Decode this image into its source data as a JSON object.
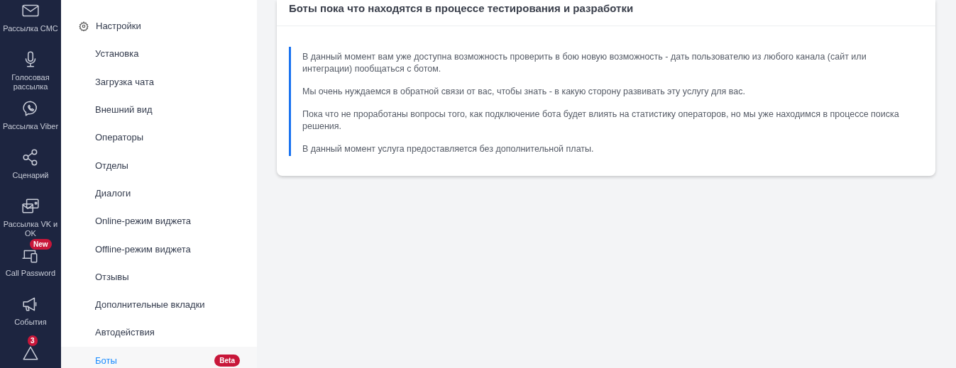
{
  "nav_rail": {
    "items": [
      {
        "label": "Рассылка СМС"
      },
      {
        "label": "Голосовая рассылка"
      },
      {
        "label": "Рассылка Viber"
      },
      {
        "label": "Сценарий"
      },
      {
        "label": "Рассылка VK и OK"
      },
      {
        "label": "Call Password",
        "badge": "New"
      },
      {
        "label": "События"
      },
      {
        "badge": "3"
      }
    ]
  },
  "sidebar": {
    "items": [
      {
        "label": "Настройки",
        "kind": "section",
        "selected": false
      },
      {
        "label": "Установка",
        "kind": "sub",
        "selected": false
      },
      {
        "label": "Загрузка чата",
        "kind": "sub",
        "selected": false
      },
      {
        "label": "Внешний вид",
        "kind": "sub",
        "selected": false
      },
      {
        "label": "Операторы",
        "kind": "sub",
        "selected": false
      },
      {
        "label": "Отделы",
        "kind": "sub",
        "selected": false
      },
      {
        "label": "Диалоги",
        "kind": "sub",
        "selected": false
      },
      {
        "label": "Online-режим виджета",
        "kind": "sub",
        "selected": false
      },
      {
        "label": "Offline-режим виджета",
        "kind": "sub",
        "selected": false
      },
      {
        "label": "Отзывы",
        "kind": "sub",
        "selected": false
      },
      {
        "label": "Дополнительные вкладки",
        "kind": "sub",
        "selected": false
      },
      {
        "label": "Автодействия",
        "kind": "sub",
        "selected": false
      },
      {
        "label": "Боты",
        "kind": "sub",
        "selected": true,
        "badge": "Beta"
      }
    ]
  },
  "card": {
    "title": "Боты пока что находятся в процессе тестирования и разработки",
    "paragraphs": [
      "В данный момент вам уже доступна возможность проверить в бою новую возможность - дать пользователю из любого канала (сайт или интеграции) пообщаться с ботом.",
      "Мы очень нуждаемся в обратной связи от вас, чтобы знать - в какую сторону развивать эту услугу для вас.",
      "Пока что не проработаны вопросы того, как подключение бота будет влиять на статистику операторов, но мы уже находимся в процессе поиска решения.",
      "В данный момент услуга предоставляется без дополнительной платы."
    ]
  }
}
